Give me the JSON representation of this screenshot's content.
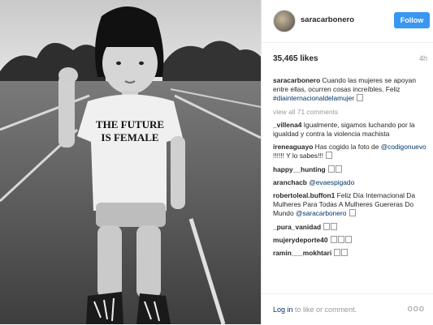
{
  "post": {
    "username": "saracarbonero",
    "follow_label": "Follow",
    "likes": "35,465 likes",
    "time": "4h",
    "shirt_text_line1": "THE FUTURE",
    "shirt_text_line2": "IS FEMALE"
  },
  "caption": {
    "user": "saracarbonero",
    "text": "Cuando las mujeres se apoyan entre ellas, ocurren cosas increíbles. Feliz",
    "hashtag": "#diainternacionaldelamujer"
  },
  "view_all": "view all 71 comments",
  "comments": [
    {
      "user": "_villena4",
      "text": "Igualmente, sigamos luchando por la igualdad y contra la violencia machista"
    },
    {
      "user": "ireneaguayo",
      "text": "Has cogido la foto de",
      "mention": "@codigonuevo",
      "after": "!!!!!! Y lo sabes!!!"
    },
    {
      "user": "happy__hunting",
      "text": ""
    },
    {
      "user": "aranchacb",
      "text": "",
      "mention": "@evaespigado"
    },
    {
      "user": "robertoleal.buffon1",
      "text": "Feliz Día Internacional Da Mulheres Para Todas A Mulheres Guereras Do Mundo",
      "mention": "@saracarbonero"
    },
    {
      "user": "_pura_vanidad",
      "text": ""
    },
    {
      "user": "mujerydeporte40",
      "text": ""
    },
    {
      "user": "ramin___mokhtari",
      "text": ""
    }
  ],
  "footer": {
    "login_link": "Log in",
    "login_text": "to like or comment.",
    "more_label": "ooo"
  }
}
